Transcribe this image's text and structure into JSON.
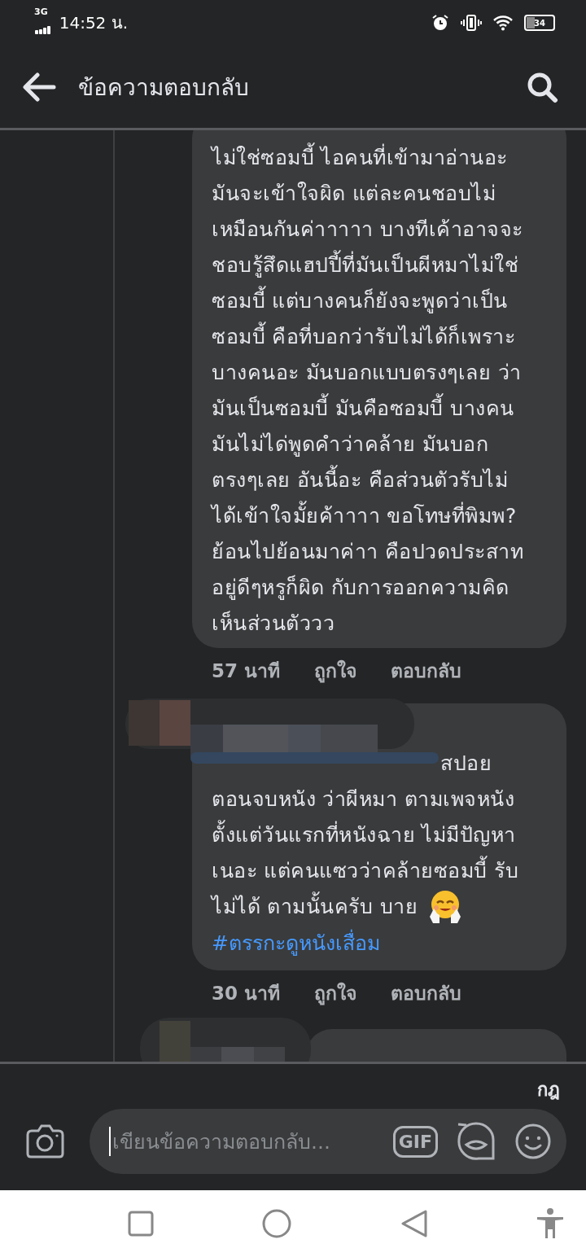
{
  "status_bar": {
    "network": "3G",
    "time": "14:52 น.",
    "battery": "34"
  },
  "header": {
    "title": "ข้อความตอบกลับ"
  },
  "comments": [
    {
      "lines": [
        "ไม่ใช่ซอมบี้ ไอคนที่เข้ามาอ่านอะ",
        "มันจะเข้าใจผิด แต่ละคนชอบไม่",
        "เหมือนกันค่าาาาา บางทีเค้าอาจจะ",
        "ชอบรู้สึดแฮปปี้ที่มันเป็นผีหมาไม่ใช่",
        "ซอมบี้ แต่บางคนก็ยังจะพูดว่าเป็น",
        "ซอมบี้ คือที่บอกว่ารับไม่ได้ก็เพราะ",
        "บางคนอะ มันบอกแบบตรงๆเลย ว่า",
        "มันเป็นซอมบี้ มันคือซอมบี้ บางคน",
        "มันไม่ได่พูดคำว่าคล้าย มันบอก",
        "ตรงๆเลย อันนี้อะ คือส่วนตัวรับไม่",
        "ได้เข้าใจมั้ยค้าาาา ขอโทษที่พิมพ?",
        "ย้อนไปย้อนมาค่าา คือปวดประสาท",
        "อยู่ดีๆหรูก็ผิด กับการออกความคิด",
        "เห็นส่วนตัววว"
      ],
      "emoji": false,
      "time": "57 นาที",
      "like": "ถูกใจ",
      "reply": "ตอบกลับ",
      "author_redacted": false
    },
    {
      "lead": "สปอย",
      "lines": [
        "ตอนจบหนัง ว่าผีหมา ตามเพจหนัง",
        "ตั้งแต่วันแรกที่หนังฉาย ไม่มีปัญหา",
        "เนอะ แต่คนแซวว่าคล้ายซอมบี้ รับ",
        "ไม่ได้ ตามนั้นครับ บาย"
      ],
      "emoji": true,
      "hashtag": "#ตรรกะดูหนังเสื่อม",
      "time": "30 นาที",
      "like": "ถูกใจ",
      "reply": "ตอบกลับ",
      "author_redacted": true
    }
  ],
  "partial_comment": {
    "author_redacted": true
  },
  "composer": {
    "rules_link": "กฎ",
    "placeholder": "เขียนข้อความตอบกลับ...",
    "gif": "GIF"
  }
}
